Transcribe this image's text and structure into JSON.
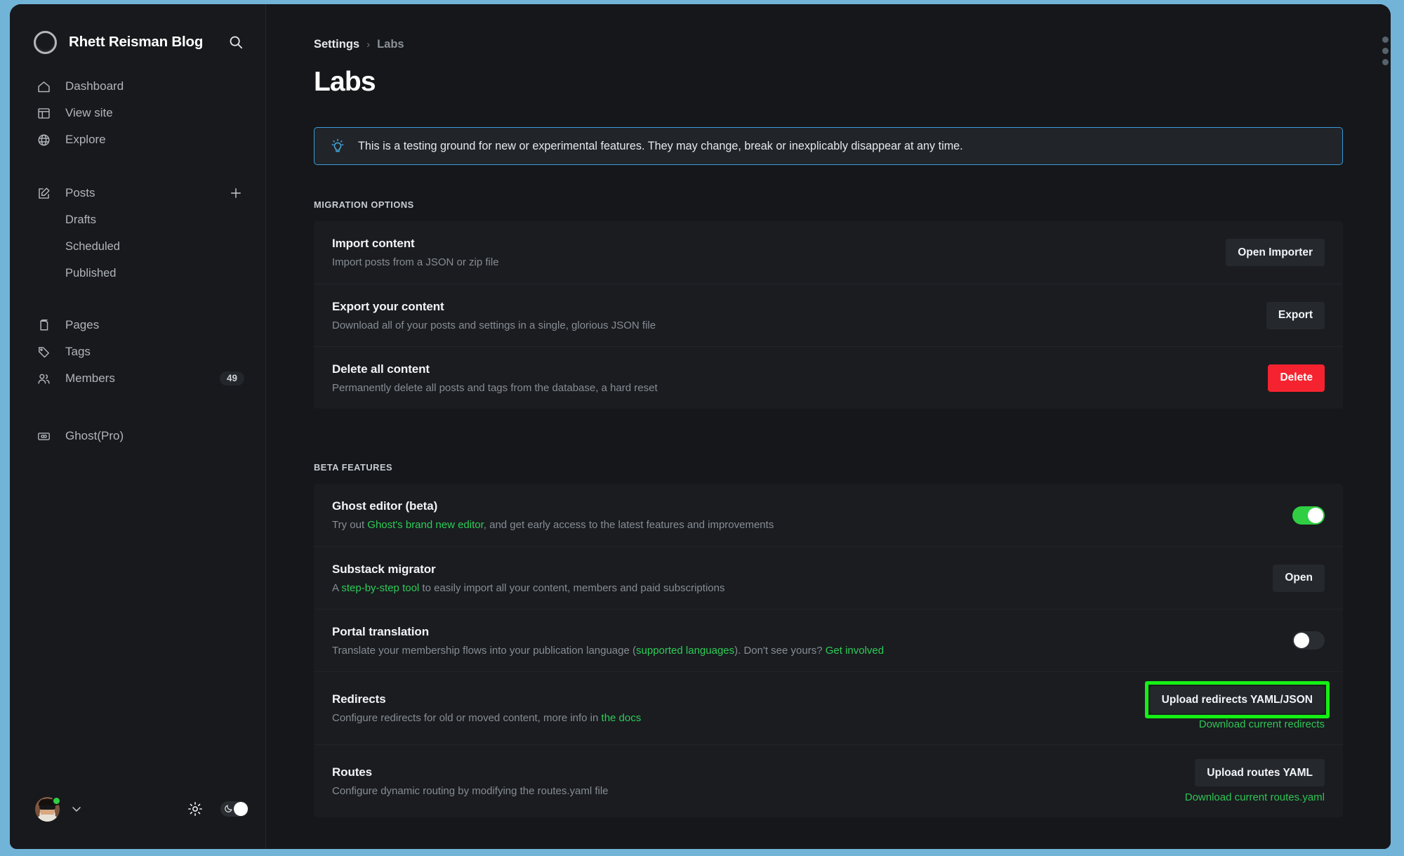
{
  "sidebar": {
    "brand": {
      "title": "Rhett Reisman Blog",
      "logo_icon": "ring-logo",
      "search_icon": "search-icon"
    },
    "nav": [
      {
        "label": "Dashboard",
        "icon": "home-icon"
      },
      {
        "label": "View site",
        "icon": "layout-icon"
      },
      {
        "label": "Explore",
        "icon": "globe-icon"
      }
    ],
    "posts": {
      "label": "Posts",
      "icon": "edit-icon",
      "add_icon": "plus-icon"
    },
    "posts_sub": [
      {
        "label": "Drafts"
      },
      {
        "label": "Scheduled"
      },
      {
        "label": "Published"
      }
    ],
    "content": [
      {
        "label": "Pages",
        "icon": "pages-icon"
      },
      {
        "label": "Tags",
        "icon": "tag-icon"
      },
      {
        "label": "Members",
        "icon": "members-icon",
        "badge": "49"
      }
    ],
    "pro": {
      "label": "Ghost(Pro)",
      "icon": "ghost-pro-icon"
    },
    "footer": {
      "avatar_icon": "avatar",
      "status": "online",
      "chevron_icon": "chevron-down-icon",
      "gear_icon": "gear-icon",
      "dark_mode_toggle": {
        "icon": "moon-icon",
        "state": "on"
      }
    }
  },
  "main": {
    "breadcrumb": {
      "parent": "Settings",
      "separator": "›",
      "current": "Labs"
    },
    "title": "Labs",
    "notice": {
      "icon": "lightbulb-icon",
      "text": "This is a testing ground for new or experimental features. They may change, break or inexplicably disappear at any time."
    },
    "sections": [
      {
        "label": "Migration options",
        "rows": [
          {
            "title": "Import content",
            "desc_before": "Import posts from a JSON or zip file",
            "button": "Open Importer",
            "button_style": "default"
          },
          {
            "title": "Export your content",
            "desc_before": "Download all of your posts and settings in a single, glorious JSON file",
            "button": "Export",
            "button_style": "default"
          },
          {
            "title": "Delete all content",
            "desc_before": "Permanently delete all posts and tags from the database, a hard reset",
            "button": "Delete",
            "button_style": "danger"
          }
        ]
      },
      {
        "label": "Beta features",
        "rows": [
          {
            "title": "Ghost editor (beta)",
            "desc_before": "Try out ",
            "desc_link": "Ghost's brand new editor",
            "desc_after": ", and get early access to the latest features and improvements",
            "control": "toggle",
            "toggle_state": "on"
          },
          {
            "title": "Substack migrator",
            "desc_before": "A ",
            "desc_link": "step-by-step tool",
            "desc_after": " to easily import all your content, members and paid subscriptions",
            "button": "Open",
            "button_style": "default"
          },
          {
            "title": "Portal translation",
            "desc_before": "Translate your membership flows into your publication language (",
            "desc_link": "supported languages",
            "desc_after": "). Don't see yours? ",
            "desc_link2": "Get involved",
            "control": "toggle",
            "toggle_state": "off"
          },
          {
            "title": "Redirects",
            "desc_before": "Configure redirects for old or moved content, more info in ",
            "desc_link": "the docs",
            "button": "Upload redirects YAML/JSON",
            "button_style": "default",
            "sub_link": "Download current redirects",
            "highlighted": true
          },
          {
            "title": "Routes",
            "desc_before": "Configure dynamic routing by modifying the routes.yaml file",
            "button": "Upload routes YAML",
            "button_style": "default",
            "sub_link": "Download current routes.yaml"
          }
        ]
      }
    ]
  },
  "colors": {
    "accent_green": "#30c455",
    "highlight_green": "#14f014",
    "danger_red": "#f5232f",
    "notice_border_blue": "#3b9bdc",
    "frame_blue": "#72b4d8",
    "page_bg": "#15171a",
    "card_bg": "#1a1c20"
  }
}
